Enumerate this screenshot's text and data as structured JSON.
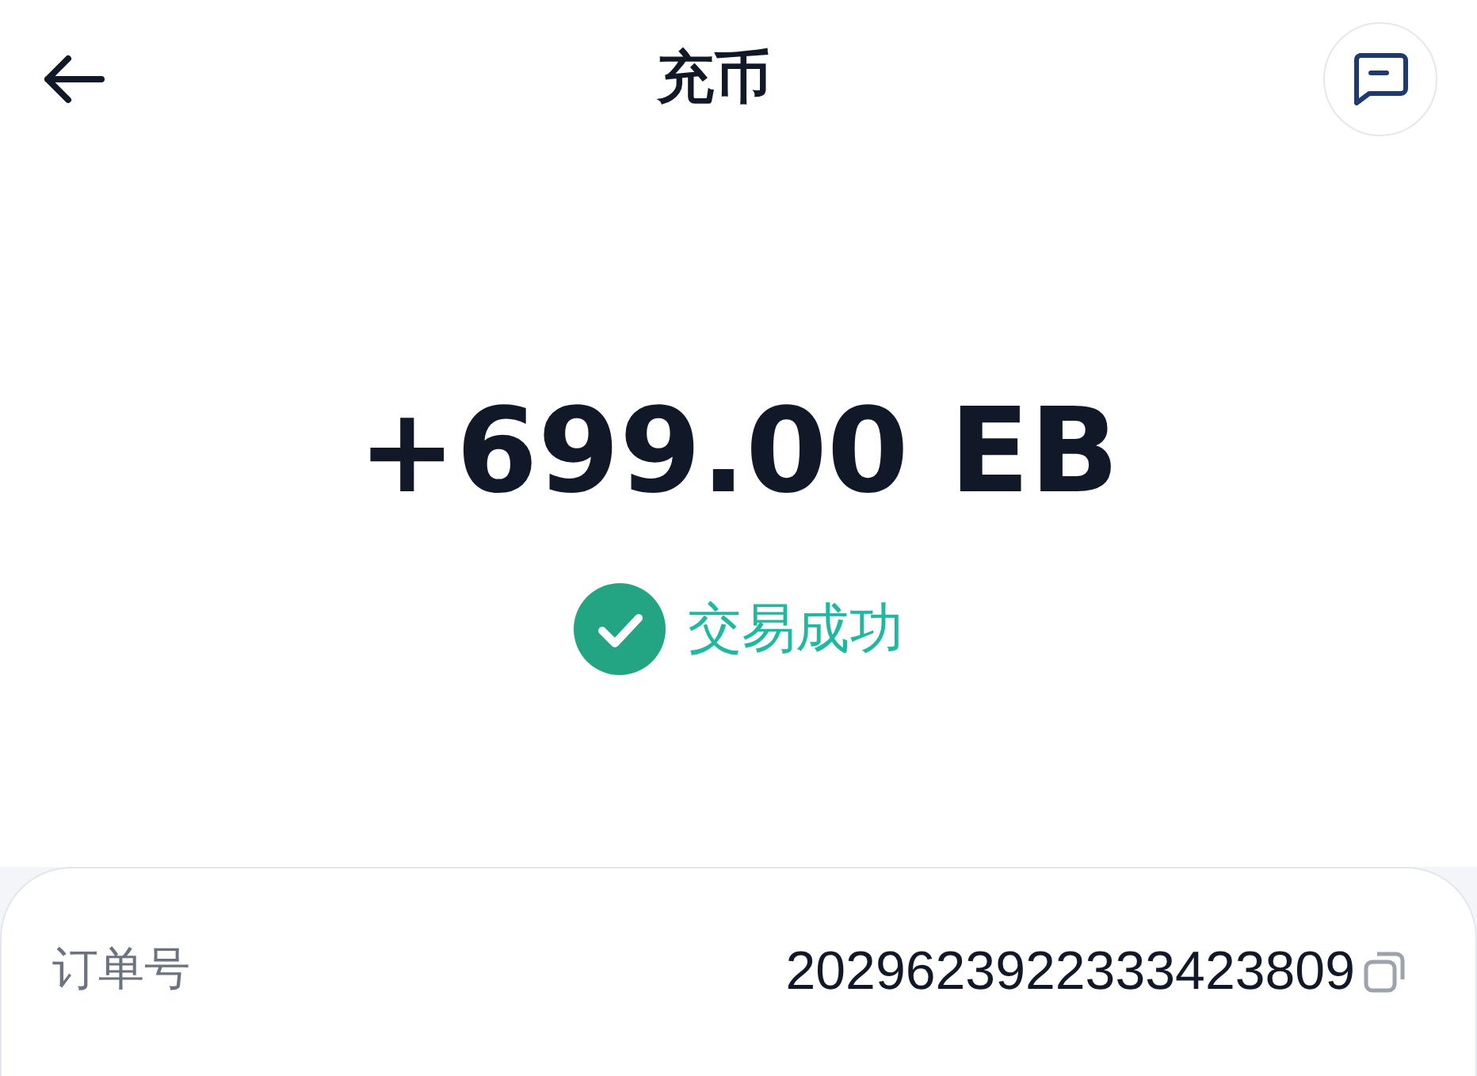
{
  "header": {
    "title": "充币"
  },
  "amount": "+699.00 EB",
  "status": {
    "kind": "success",
    "text": "交易成功"
  },
  "details": [
    {
      "label": "订单号",
      "value": "2029623922333423809",
      "copyable": true
    }
  ]
}
